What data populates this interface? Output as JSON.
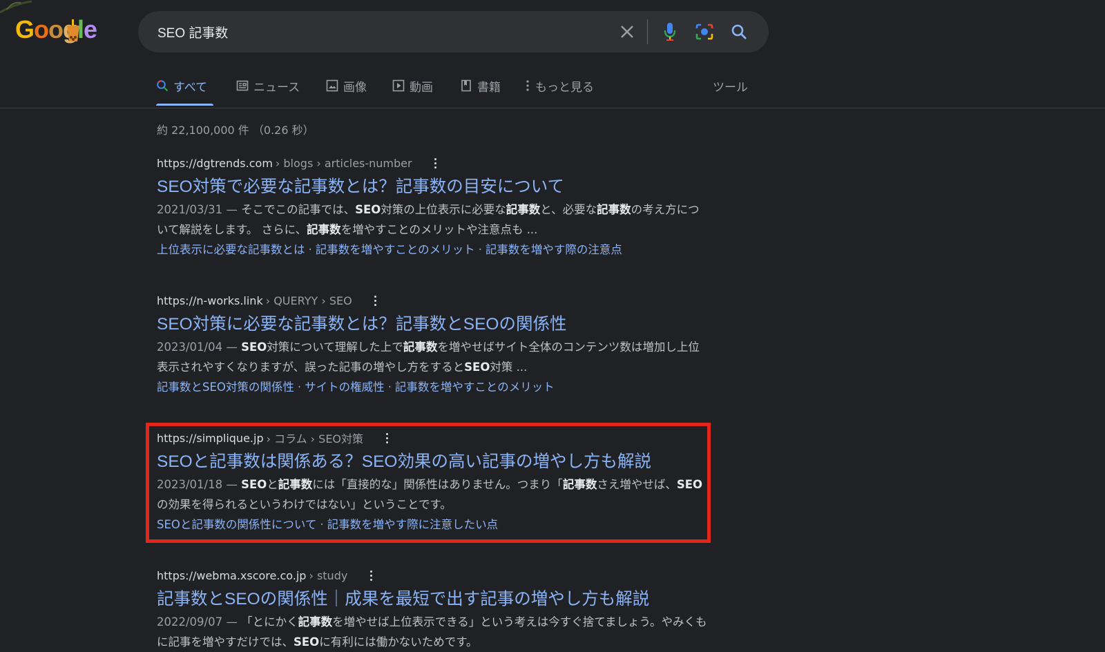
{
  "logo": {
    "letters": [
      "G",
      "o",
      "o",
      "g",
      "l",
      "e"
    ],
    "colors": [
      "#f2b90f",
      "#ea6f1a",
      "#9aa0a6",
      "#ddb36a",
      "#66bb55",
      "#b58cf2"
    ]
  },
  "search": {
    "query": "SEO 記事数"
  },
  "icons": {
    "clear": "close-icon",
    "voice": "microphone-icon",
    "lens": "camera-lens-icon",
    "search": "search-icon"
  },
  "tabs": [
    {
      "label": "すべて",
      "icon": "search-icon",
      "active": true
    },
    {
      "label": "ニュース",
      "icon": "news-icon"
    },
    {
      "label": "画像",
      "icon": "image-icon"
    },
    {
      "label": "動画",
      "icon": "video-icon"
    },
    {
      "label": "書籍",
      "icon": "book-icon"
    },
    {
      "label": "もっと見る",
      "icon": "more-vert-icon"
    }
  ],
  "tools_label": "ツール",
  "stats": "約 22,100,000 件 （0.26 秒）",
  "results": [
    {
      "url": "https://dgtrends.com",
      "breadcrumbs": "› blogs › articles-number",
      "title": "SEO対策で必要な記事数とは？記事数の目安について",
      "date": "2021/03/31 —",
      "snippet": [
        {
          "t": " そこでこの記事では、"
        },
        {
          "t": "SEO",
          "b": true
        },
        {
          "t": "対策の上位表示に必要な"
        },
        {
          "t": "記事数",
          "b": true
        },
        {
          "t": "と、必要な"
        },
        {
          "t": "記事数",
          "b": true
        },
        {
          "t": "の考え方について解説をします。 さらに、"
        },
        {
          "t": "記事数",
          "b": true
        },
        {
          "t": "を増やすことのメリットや注意点も ..."
        }
      ],
      "sitelinks": [
        "上位表示に必要な記事数とは",
        "記事数を増やすことのメリット",
        "記事数を増やす際の注意点"
      ]
    },
    {
      "url": "https://n-works.link",
      "breadcrumbs": "› QUERYY › SEO",
      "title": "SEO対策に必要な記事数とは？記事数とSEOの関係性",
      "date": "2023/01/04 —",
      "snippet": [
        {
          "t": " "
        },
        {
          "t": "SEO",
          "b": true
        },
        {
          "t": "対策について理解した上で"
        },
        {
          "t": "記事数",
          "b": true
        },
        {
          "t": "を増やせばサイト全体のコンテンツ数は増加し上位表示されやすくなりますが、誤った記事の増やし方をすると"
        },
        {
          "t": "SEO",
          "b": true
        },
        {
          "t": "対策 ..."
        }
      ],
      "sitelinks": [
        "記事数とSEO対策の関係性",
        "サイトの権威性",
        "記事数を増やすことのメリット"
      ]
    },
    {
      "url": "https://simplique.jp",
      "breadcrumbs": "› コラム › SEO対策",
      "title": "SEOと記事数は関係ある？SEO効果の高い記事の増やし方も解説",
      "date": "2023/01/18 —",
      "snippet": [
        {
          "t": " "
        },
        {
          "t": "SEO",
          "b": true
        },
        {
          "t": "と"
        },
        {
          "t": "記事数",
          "b": true
        },
        {
          "t": "には「直接的な」関係性はありません。つまり「"
        },
        {
          "t": "記事数",
          "b": true
        },
        {
          "t": "さえ増やせば、"
        },
        {
          "t": "SEO",
          "b": true
        },
        {
          "t": "の効果を得られるというわけではない」ということです。"
        }
      ],
      "sitelinks": [
        "SEOと記事数の関係性について",
        "記事数を増やす際に注意したい点"
      ],
      "highlighted": true
    },
    {
      "url": "https://webma.xscore.co.jp",
      "breadcrumbs": "› study",
      "title": "記事数とSEOの関係性｜成果を最短で出す記事の増やし方も解説",
      "date": "2022/09/07 —",
      "snippet": [
        {
          "t": " 「とにかく"
        },
        {
          "t": "記事数",
          "b": true
        },
        {
          "t": "を増やせば上位表示できる」という考えは今すぐ捨てましょう。やみくもに記事を増やすだけでは、"
        },
        {
          "t": "SEO",
          "b": true
        },
        {
          "t": "に有利には働かないためです。"
        }
      ],
      "sitelinks": []
    }
  ],
  "colors": {
    "background": "#202124",
    "link": "#8ab4f8",
    "text": "#bdc1c6",
    "highlight_border": "#e2261b"
  }
}
